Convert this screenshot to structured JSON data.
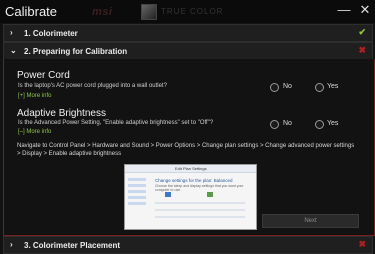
{
  "window": {
    "title": "Calibrate",
    "logo_text": "msi",
    "brand_text": "TRUE COLOR",
    "minimize_glyph": "—",
    "close_glyph": "✕"
  },
  "sections": [
    {
      "number_label": "1. Colorimeter",
      "status": "complete",
      "status_glyph": "✔",
      "chevron": "›"
    },
    {
      "number_label": "2. Preparing for Calibration",
      "status": "incomplete",
      "status_glyph": "✖",
      "chevron": "⌄"
    },
    {
      "number_label": "3. Colorimeter Placement",
      "status": "incomplete",
      "status_glyph": "✖",
      "chevron": "›"
    }
  ],
  "power_cord": {
    "heading": "Power Cord",
    "question": "Is the laptop's AC power cord plugged into a wall outlet?",
    "more": "[+] More info",
    "no_label": "No",
    "yes_label": "Yes"
  },
  "adaptive_brightness": {
    "heading": "Adaptive Brightness",
    "question": "Is the Advanced Power Setting, \"Enable adaptive brightness\" set to \"Off\"?",
    "more": "[–] More info",
    "no_label": "No",
    "yes_label": "Yes",
    "navigate": "Navigate to Control Panel > Hardware and Sound > Power Options > Change plan settings > Change advanced power settings > Display > Enable adaptive brightness"
  },
  "screenshot": {
    "window_title": "Edit Plan Settings",
    "heading": "Change settings for the plan: Balanced",
    "sub": "Choose the sleep and display settings that you want your computer to use."
  },
  "next_button": "Next",
  "colors": {
    "accent_green": "#8cc83c",
    "status_red": "#b02020",
    "panel_border": "#7a1f1f"
  }
}
